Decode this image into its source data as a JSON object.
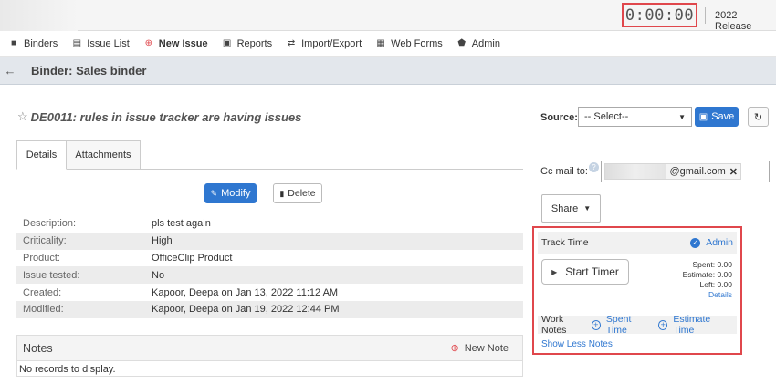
{
  "topbar": {
    "timer": "0:00:00",
    "release": "2022 Release"
  },
  "nav": {
    "items": [
      {
        "label": "Binders",
        "icon": "briefcase-icon"
      },
      {
        "label": "Issue List",
        "icon": "list-icon"
      },
      {
        "label": "New Issue",
        "icon": "plus-circle-icon"
      },
      {
        "label": "Reports",
        "icon": "chart-icon"
      },
      {
        "label": "Import/Export",
        "icon": "arrows-icon"
      },
      {
        "label": "Web Forms",
        "icon": "form-icon"
      },
      {
        "label": "Admin",
        "icon": "shield-icon"
      }
    ]
  },
  "binder": {
    "title": "Binder: Sales binder"
  },
  "issue": {
    "title": "DE0011: rules in issue tracker are having issues",
    "tabs": [
      "Details",
      "Attachments"
    ],
    "modify_label": "Modify",
    "delete_label": "Delete",
    "fields": [
      {
        "label": "Description:",
        "value": "pls test again"
      },
      {
        "label": "Criticality:",
        "value": "High"
      },
      {
        "label": "Product:",
        "value": "OfficeClip Product"
      },
      {
        "label": "Issue tested:",
        "value": "No"
      },
      {
        "label": "Created:",
        "value": "Kapoor, Deepa on Jan 13, 2022 11:12 AM"
      },
      {
        "label": "Modified:",
        "value": "Kapoor, Deepa on Jan 19, 2022 12:44 PM"
      }
    ]
  },
  "notes": {
    "title": "Notes",
    "new_note": "New Note",
    "empty": "No records to display."
  },
  "side": {
    "source_label": "Source:",
    "source_value": "-- Select--",
    "save_label": "Save",
    "cc_label": "Cc mail to:",
    "cc_email": "@gmail.com",
    "share_label": "Share"
  },
  "track": {
    "title": "Track Time",
    "admin": "Admin",
    "start_timer": "Start Timer",
    "spent": "Spent: 0.00",
    "estimate": "Estimate: 0.00",
    "left": "Left: 0.00",
    "details": "Details",
    "work_notes": "Work Notes",
    "spent_time": "Spent Time",
    "estimate_time": "Estimate Time",
    "show_less": "Show Less Notes"
  },
  "colors": {
    "accent": "#2f77d0",
    "highlight": "#e0474c"
  }
}
